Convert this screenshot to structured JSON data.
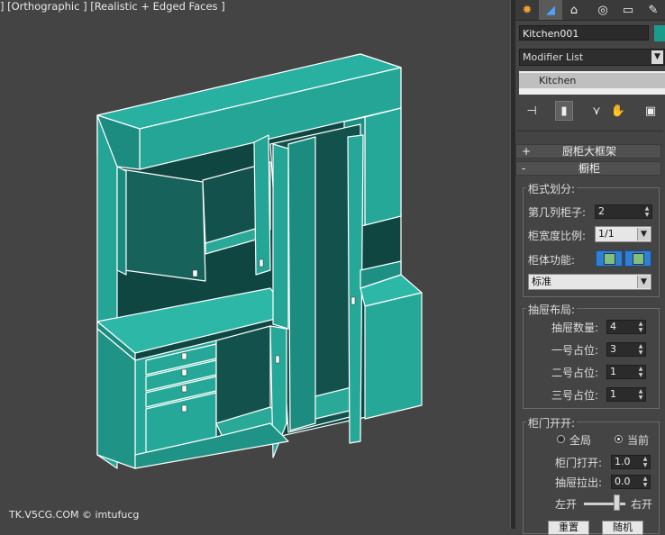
{
  "viewport": {
    "label": "] [Orthographic ] [Realistic + Edged Faces ]",
    "watermark": "TK.V5CG.COM © imtufucg"
  },
  "panel": {
    "tabs": [
      {
        "icon": "sun-icon",
        "glyph": "✹"
      },
      {
        "icon": "modify-icon",
        "glyph": "◢"
      },
      {
        "icon": "hierarchy-icon",
        "glyph": "⌂"
      },
      {
        "icon": "motion-icon",
        "glyph": "◎"
      },
      {
        "icon": "display-icon",
        "glyph": "▭"
      },
      {
        "icon": "utilities-icon",
        "glyph": "✎"
      }
    ],
    "object_name": "Kitchen001",
    "object_color": "#1a9c8c",
    "modifier_list": "Modifier List",
    "stack_item": "Kitchen",
    "rollouts": {
      "frame": {
        "sign": "+",
        "title": "厨柜大框架"
      },
      "cabinet": {
        "sign": "-",
        "title": "橱柜"
      }
    },
    "division": {
      "title": "柜式划分:",
      "column_label": "第几列柜子:",
      "column_value": "2",
      "ratio_label": "柜宽度比例:",
      "ratio_value": "1/1",
      "function_label": "柜体功能:",
      "mode_value": "标准"
    },
    "drawer": {
      "title": "抽屉布局:",
      "count_label": "抽屉数量:",
      "count_value": "4",
      "pos1_label": "一号占位:",
      "pos1_value": "3",
      "pos2_label": "二号占位:",
      "pos2_value": "1",
      "pos3_label": "三号占位:",
      "pos3_value": "1"
    },
    "door": {
      "title": "柜门开开:",
      "global_label": "全局",
      "current_label": "当前",
      "selected": "current",
      "open_label": "柜门打开:",
      "open_value": "1.0",
      "pull_label": "抽屉拉出:",
      "pull_value": "0.0",
      "left_label": "左开",
      "right_label": "右开",
      "slider_fraction": 0.85,
      "reset_label": "重置",
      "random_label": "随机"
    }
  },
  "colors": {
    "teal": "#23a596",
    "teal_dark": "#0e3f3a",
    "accent": "#2f7fd6"
  }
}
